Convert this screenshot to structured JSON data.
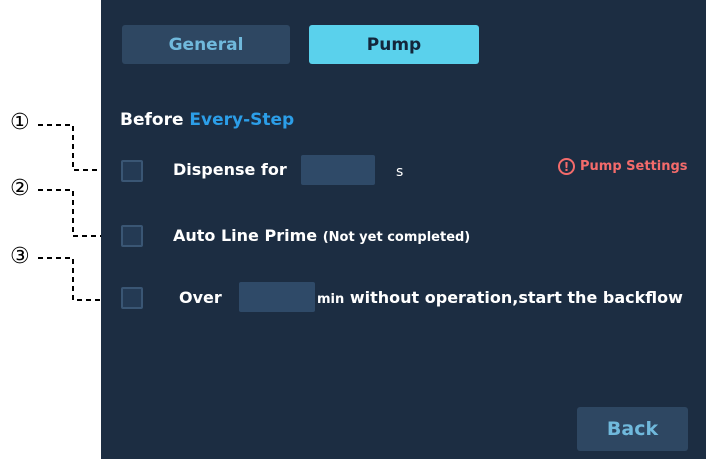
{
  "tabs": [
    {
      "label": "General",
      "active": false
    },
    {
      "label": "Pump",
      "active": true
    }
  ],
  "heading": {
    "prefix": "Before",
    "accent": "Every-Step"
  },
  "options": {
    "dispense": {
      "label": "Dispense for",
      "value": "",
      "unit": "s",
      "checked": false
    },
    "auto_line_prime": {
      "label": "Auto Line Prime",
      "note": "(Not yet completed)",
      "checked": false
    },
    "backflow": {
      "label_prefix": "Over",
      "value": "",
      "unit": "min",
      "label_suffix": "without operation,start the backflow",
      "checked": false
    }
  },
  "warning": {
    "icon": "exclamation-circle-icon",
    "label": "Pump Settings"
  },
  "back_label": "Back",
  "annotations": [
    "①",
    "②",
    "③"
  ],
  "colors": {
    "panel_bg": "#1c2d42",
    "tab_active_bg": "#5ad1ec",
    "tab_inactive_bg": "#2e4762",
    "accent_blue": "#2c9ee8",
    "warning_red": "#f46b6b"
  }
}
